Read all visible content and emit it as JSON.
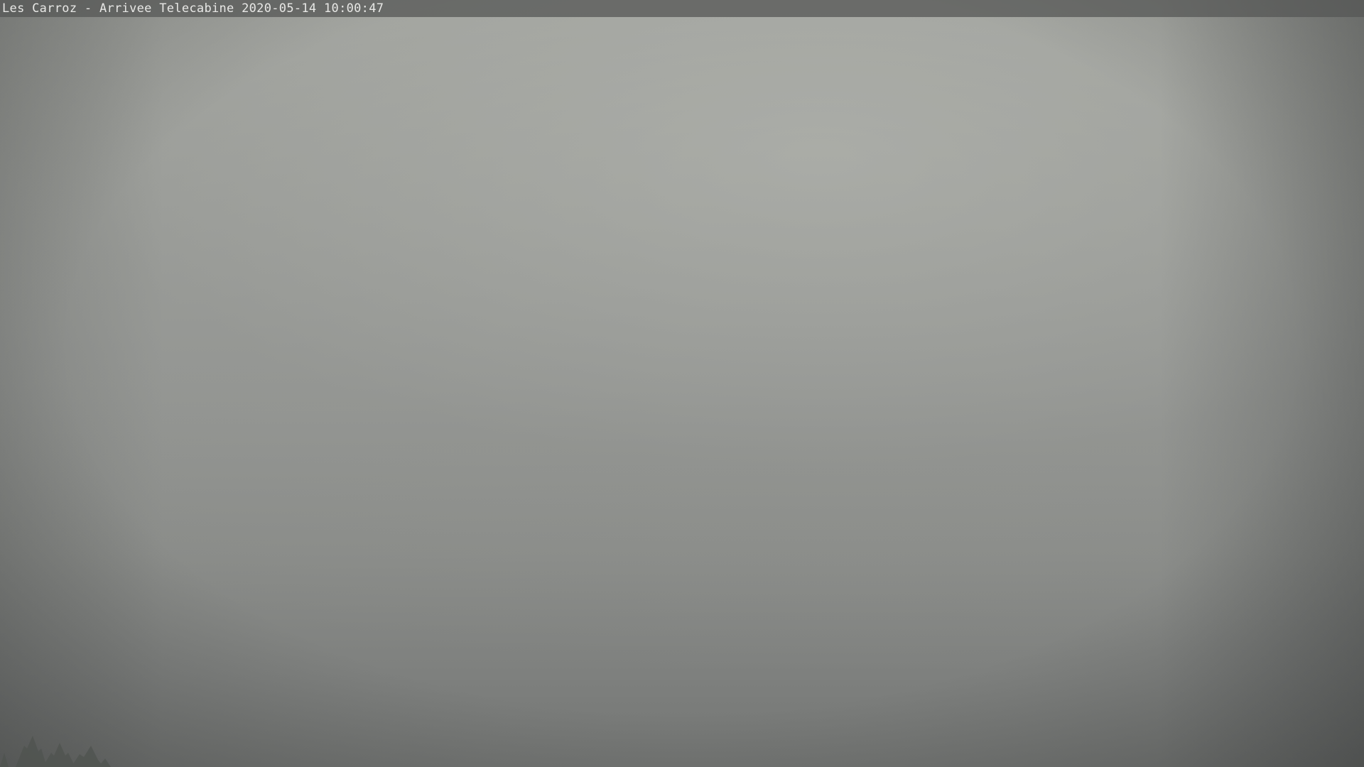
{
  "camera": {
    "overlay_text": "Les Carroz - Arrivee Telecabine 2020-05-14 10:00:47"
  },
  "scene": {
    "sky_color": "#9c9e9a",
    "fog_dark_color": "#737573",
    "tree_color": "#4a4e4a"
  }
}
